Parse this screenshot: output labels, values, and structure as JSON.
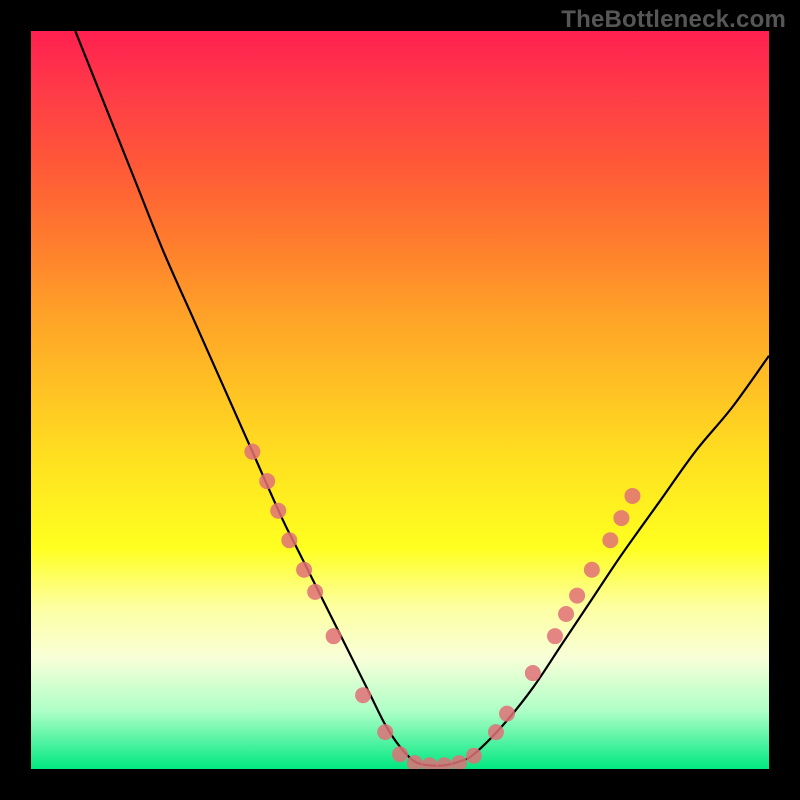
{
  "watermark": "TheBottleneck.com",
  "chart_data": {
    "type": "line",
    "title": "",
    "xlabel": "",
    "ylabel": "",
    "xlim": [
      0,
      100
    ],
    "ylim": [
      0,
      100
    ],
    "grid": false,
    "legend": false,
    "series": [
      {
        "name": "bottleneck-curve",
        "color": "#000000",
        "x": [
          6,
          10,
          14,
          18,
          22,
          26,
          30,
          34,
          36,
          38,
          40,
          42,
          44,
          46,
          48,
          50,
          52,
          54,
          56,
          58,
          60,
          64,
          68,
          72,
          76,
          80,
          85,
          90,
          95,
          100
        ],
        "y": [
          100,
          90,
          80,
          70,
          61,
          52,
          43,
          34,
          30,
          26,
          22,
          18,
          14,
          10,
          6,
          3,
          1,
          0.5,
          0.5,
          1,
          2,
          6,
          11,
          17,
          23,
          29,
          36,
          43,
          49,
          56
        ]
      }
    ],
    "markers": {
      "name": "highlight-points",
      "color": "#e07078",
      "radius_px": 8,
      "points": [
        {
          "x": 30,
          "y": 43
        },
        {
          "x": 32,
          "y": 39
        },
        {
          "x": 33.5,
          "y": 35
        },
        {
          "x": 35,
          "y": 31
        },
        {
          "x": 37,
          "y": 27
        },
        {
          "x": 38.5,
          "y": 24
        },
        {
          "x": 41,
          "y": 18
        },
        {
          "x": 45,
          "y": 10
        },
        {
          "x": 48,
          "y": 5
        },
        {
          "x": 50,
          "y": 2
        },
        {
          "x": 52,
          "y": 0.8
        },
        {
          "x": 54,
          "y": 0.5
        },
        {
          "x": 56,
          "y": 0.5
        },
        {
          "x": 58,
          "y": 0.8
        },
        {
          "x": 60,
          "y": 1.8
        },
        {
          "x": 63,
          "y": 5
        },
        {
          "x": 64.5,
          "y": 7.5
        },
        {
          "x": 68,
          "y": 13
        },
        {
          "x": 71,
          "y": 18
        },
        {
          "x": 72.5,
          "y": 21
        },
        {
          "x": 74,
          "y": 23.5
        },
        {
          "x": 76,
          "y": 27
        },
        {
          "x": 78.5,
          "y": 31
        },
        {
          "x": 80,
          "y": 34
        },
        {
          "x": 81.5,
          "y": 37
        }
      ]
    },
    "gradient_stops": [
      {
        "pos": 0.0,
        "color": "#ff2050"
      },
      {
        "pos": 0.35,
        "color": "#ffa028"
      },
      {
        "pos": 0.7,
        "color": "#ffff20"
      },
      {
        "pos": 0.92,
        "color": "#b0ffc8"
      },
      {
        "pos": 1.0,
        "color": "#00e880"
      }
    ]
  }
}
